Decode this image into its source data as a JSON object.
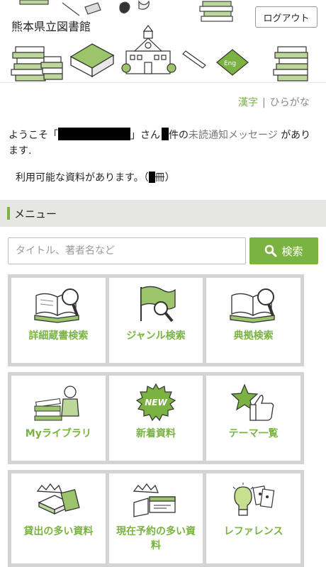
{
  "header": {
    "site_title": "熊本県立図書館",
    "logout_label": "ログアウト"
  },
  "script_toggle": {
    "kanji": "漢字",
    "separator": "|",
    "hiragana": "ひらがな"
  },
  "welcome": {
    "prefix": "ようこそ「",
    "suffix_san": "」さん",
    "count_suffix": "件の",
    "message_link": "未読通知メッセージ",
    "tail": "があります."
  },
  "availability": {
    "text": "利用可能な資料があります。（",
    "unit_close": "冊）"
  },
  "menu": {
    "title": "メニュー"
  },
  "search": {
    "placeholder": "タイトル、著者名など",
    "button_label": "検索"
  },
  "tiles": [
    {
      "label": "詳細蔵書検索",
      "icon": "book-magnifier-icon"
    },
    {
      "label": "ジャンル検索",
      "icon": "flag-magnifier-icon"
    },
    {
      "label": "典拠検索",
      "icon": "book-magnifier-icon"
    },
    {
      "label": "Myライブラリ",
      "icon": "person-books-icon"
    },
    {
      "label": "新着資料",
      "icon": "new-badge-icon"
    },
    {
      "label": "テーマ一覧",
      "icon": "star-thumbs-up-icon"
    },
    {
      "label": "貸出の多い資料",
      "icon": "crown-books-icon"
    },
    {
      "label": "現在予約の多い資料",
      "icon": "crown-card-icon"
    },
    {
      "label": "レファレンス",
      "icon": "lightbulb-cards-icon"
    }
  ],
  "colors": {
    "accent": "#7ab341",
    "menu_bg": "#e6e6e2",
    "tile_border": "#d4d4d4"
  }
}
